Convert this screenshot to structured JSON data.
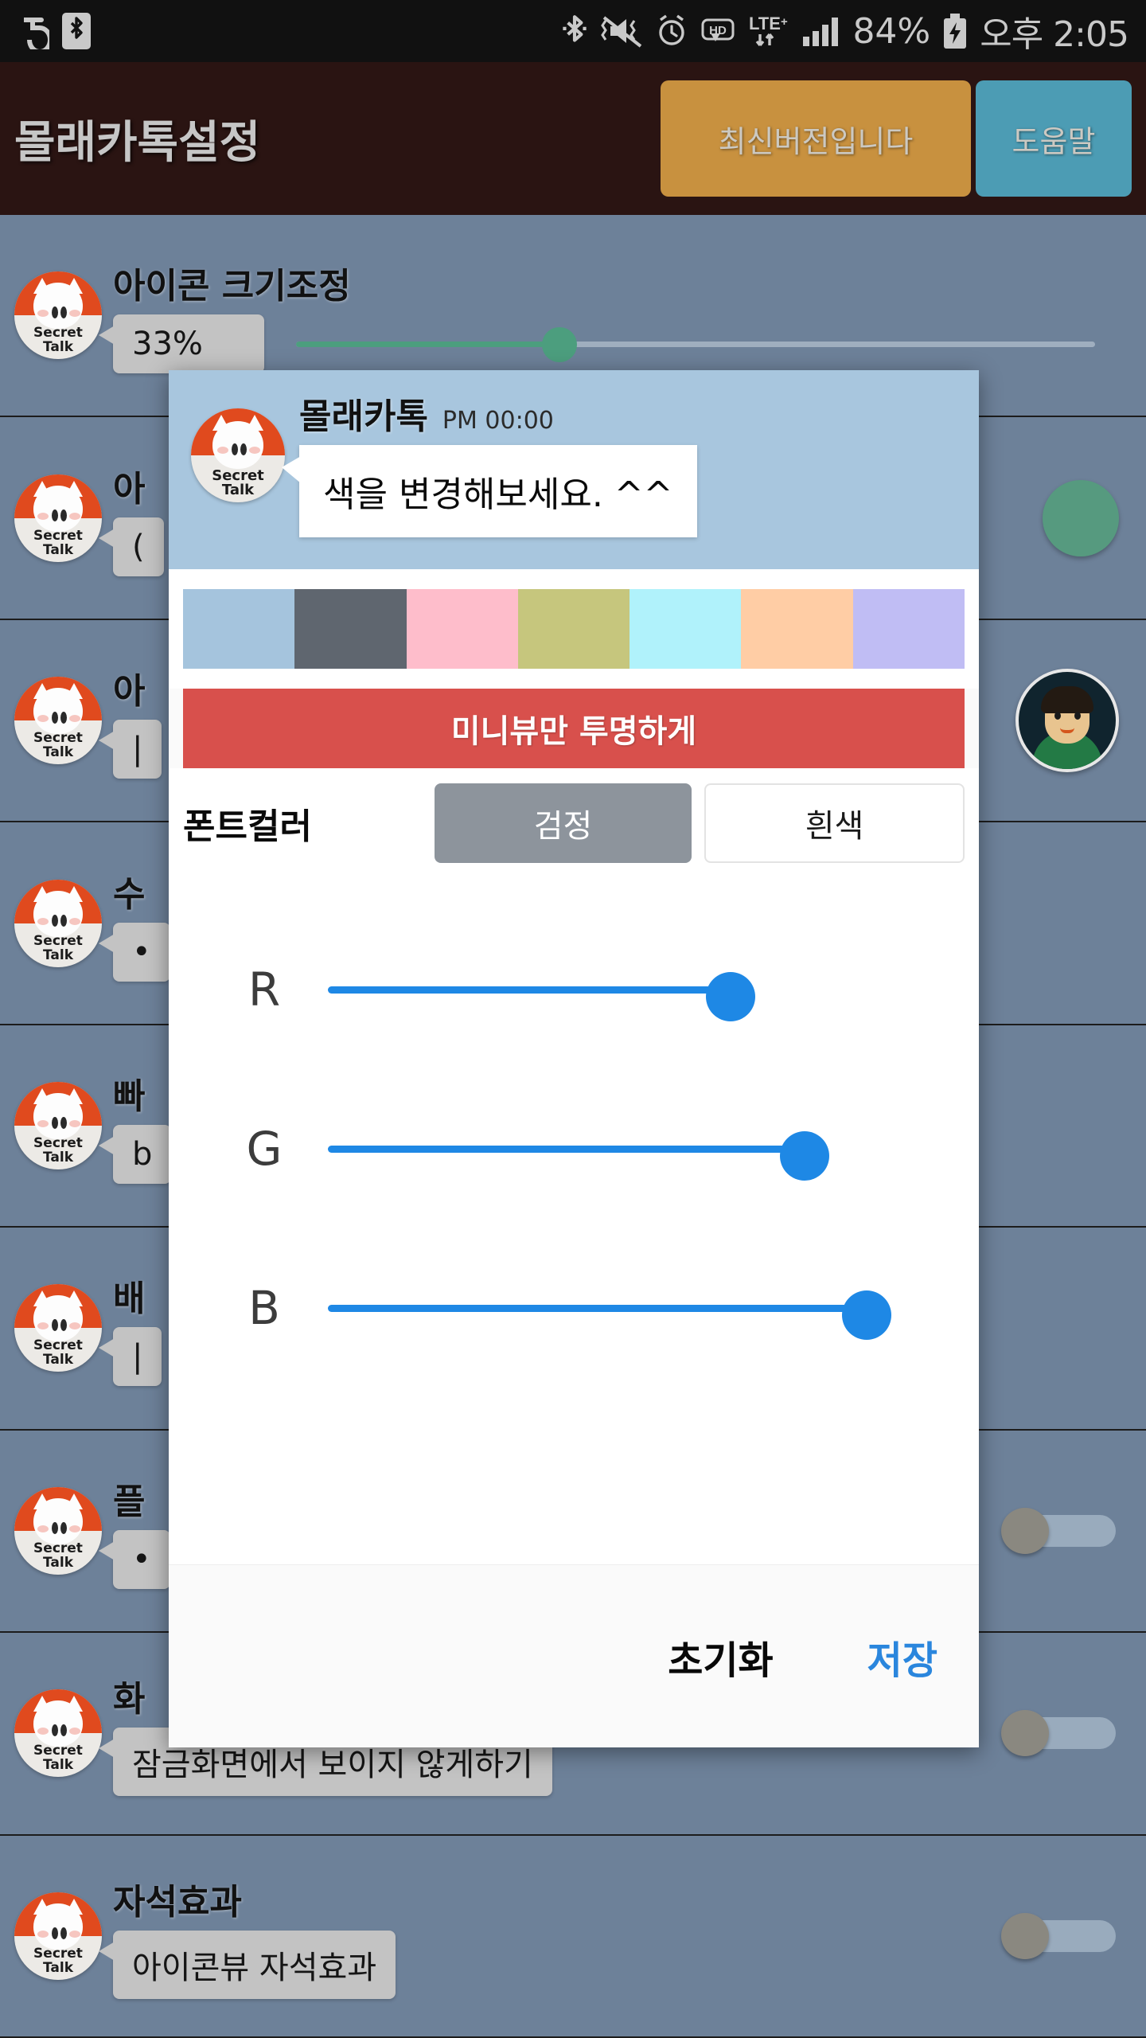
{
  "status_bar": {
    "icons_left": [
      "app-glyph-icon",
      "bluetooth-boxed-icon"
    ],
    "icons_right": [
      "bluetooth-icon",
      "mute-vibrate-icon",
      "alarm-icon",
      "hd-icon",
      "lte-plus-icon",
      "signal-bars-icon"
    ],
    "battery_percent": "84%",
    "battery_icon": "battery-charging-icon",
    "time": "오후 2:05"
  },
  "header": {
    "title": "몰래카톡설정",
    "version_button": "최신버전입니다",
    "help_button": "도움말",
    "version_color": "#c8913f",
    "help_color": "#4c9cb4",
    "background": "#2a1412"
  },
  "settings": {
    "rows": [
      {
        "title": "아이콘 크기조정",
        "bubble": "33%",
        "control": "slider",
        "slider_value": 33,
        "slider_color": "#4c9e7e"
      },
      {
        "title": "아",
        "bubble": "(",
        "control": "circle",
        "circle_color": "#569a7f"
      },
      {
        "title": "아",
        "bubble": "|",
        "control": "avatar"
      },
      {
        "title": "수",
        "bubble": "•",
        "control": "none"
      },
      {
        "title": "빠",
        "bubble": "b",
        "control": "none"
      },
      {
        "title": "배",
        "bubble": "|",
        "control": "none"
      },
      {
        "title": "플",
        "bubble": "•",
        "control": "toggle",
        "toggle_on": false
      },
      {
        "title": "화",
        "bubble": "잠금화면에서 보이지 않게하기",
        "control": "toggle",
        "toggle_on": false
      },
      {
        "title": "자석효과",
        "bubble": "아이콘뷰 자석효과",
        "control": "toggle",
        "toggle_on": false
      }
    ],
    "icon_name": "secret-talk-icon",
    "icon_label_line1": "Secret",
    "icon_label_line2": "Talk"
  },
  "dialog": {
    "preview": {
      "sender": "몰래카톡",
      "time": "PM 00:00",
      "message": "색을 변경해보세요. ^^",
      "background": "#a8c6de"
    },
    "swatches": [
      {
        "name": "swatch-light-blue",
        "color": "#a5c4dd"
      },
      {
        "name": "swatch-slate-gray",
        "color": "#5f666f"
      },
      {
        "name": "swatch-pink",
        "color": "#febdcb"
      },
      {
        "name": "swatch-khaki",
        "color": "#c6c67d"
      },
      {
        "name": "swatch-cyan",
        "color": "#b0f2fb"
      },
      {
        "name": "swatch-peach",
        "color": "#ffcda5"
      },
      {
        "name": "swatch-lavender",
        "color": "#c0bdf4"
      }
    ],
    "transparent_button": "미니뷰만 투명하게",
    "transparent_color": "#d8504c",
    "font_color": {
      "label": "폰트컬러",
      "black_option": "검정",
      "white_option": "흰색",
      "selected": "검정"
    },
    "rgb": {
      "accent": "#1e88e5",
      "channels": [
        {
          "label": "R",
          "value": 165,
          "percent": 65
        },
        {
          "label": "G",
          "value": 196,
          "percent": 77
        },
        {
          "label": "B",
          "value": 221,
          "percent": 87
        }
      ]
    },
    "actions": {
      "reset": "초기화",
      "save": "저장",
      "save_color": "#2a86dd"
    }
  }
}
